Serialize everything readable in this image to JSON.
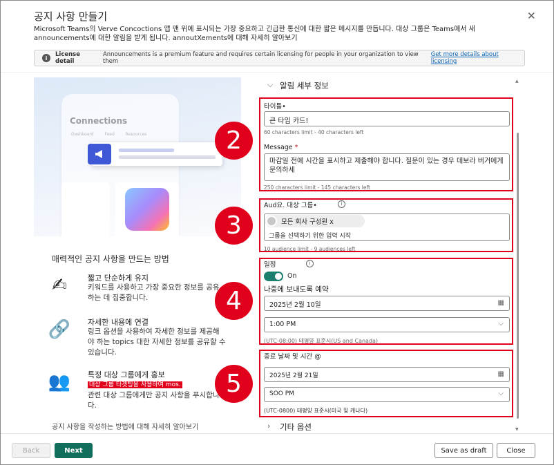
{
  "dialog": {
    "title": "공지 사항 만들기",
    "description": "Microsoft Teams의 Verve Concoctions 앱 맨 위에 표시되는 가장 중요하고 긴급한 통신에 대한 짧은 메시지를 만듭니다. 대상 그룹은 Teams에서 새 announcements에 대한 알림을 받게 됩니다. annoutXements에 대해 자세히 알아보기",
    "close_glyph": "✕"
  },
  "notice": {
    "icon_glyph": "i",
    "label": "License detail",
    "text": "Announcements is a premium feature and requires certain licensing for people in your organization to view them",
    "link": "Get more details about licensing"
  },
  "preview": {
    "app_title": "Connections",
    "tabs": "Dashboard Feed Resources",
    "banner_icon": "megaphone-icon"
  },
  "tips": {
    "heading": "매력적인 공지 사항을 만드는 방법",
    "items": [
      {
        "icon": "pencil-icon",
        "glyph": "✍",
        "title": "짧고 단순하게 유지",
        "desc": "키워드를 사용하고 가장 중요한 정보를 공유하는 데 집중합니다."
      },
      {
        "icon": "link-icon",
        "glyph": "🔗",
        "title": "자세한 내용에 연결",
        "desc": "링크 옵션을 사용하여 자세한 정보를 제공해야 하는 topics 대한 자세한 정보를 공유할 수 있습니다."
      },
      {
        "icon": "people-icon",
        "glyph": "👥",
        "title": "특정 대상 그룹에게 홍보",
        "highlight": "대상 그룹 타겟팅을 사용하여 mos.",
        "desc": "관련 대상 그룹에게만 공지 사항을 푸시합니다."
      }
    ],
    "footer": "공지 사항을 작성하는 방법에 대해 자세히 알아보기"
  },
  "form": {
    "section_title": "알림 세부 정보",
    "title_label": "타이틀•",
    "title_value": "큰 타임 카드!",
    "title_hint": "60 characters limit - 40 characters left",
    "message_label": "Message",
    "message_required": "*",
    "message_value": "마감일 전에 시간을 표시하고 제출해야 합니다. 질문이 있는 경우 데보라 버거에게 문의하세",
    "message_hint": "250 characters limit - 145 characters left",
    "audience_label": "Aud요. 대상 그룹•",
    "audience_pill": "모든 회사 구성원 x",
    "audience_placeholder": "그룹을 선택하기 위한 입력 시작",
    "audience_hint": "10 audience limit - 9 audiences left",
    "schedule_label": "일정",
    "toggle_label": "On",
    "schedule_later": "나중에 보내도록 예약",
    "send_date": "2025년 2월 10일",
    "send_time": "1:00 PM",
    "send_tz": "(UTC-08:00) 태평양 표준시(US and Canada)",
    "end_label": "종료 날짜 및 시간 @",
    "end_date": "2025년 2월 21일",
    "end_time": "SOO PM",
    "end_tz": "(UTC-0800) 태평양 표준시(미국 및 캐나다)",
    "other_options": "기타 옵션"
  },
  "badges": [
    "2",
    "3",
    "4",
    "5"
  ],
  "footer": {
    "back": "Back",
    "next": "Next",
    "save_draft": "Save as draft",
    "close": "Close"
  },
  "colors": {
    "accent": "#126e5c",
    "highlight_red": "#e0001b",
    "link": "#0b63b5"
  }
}
